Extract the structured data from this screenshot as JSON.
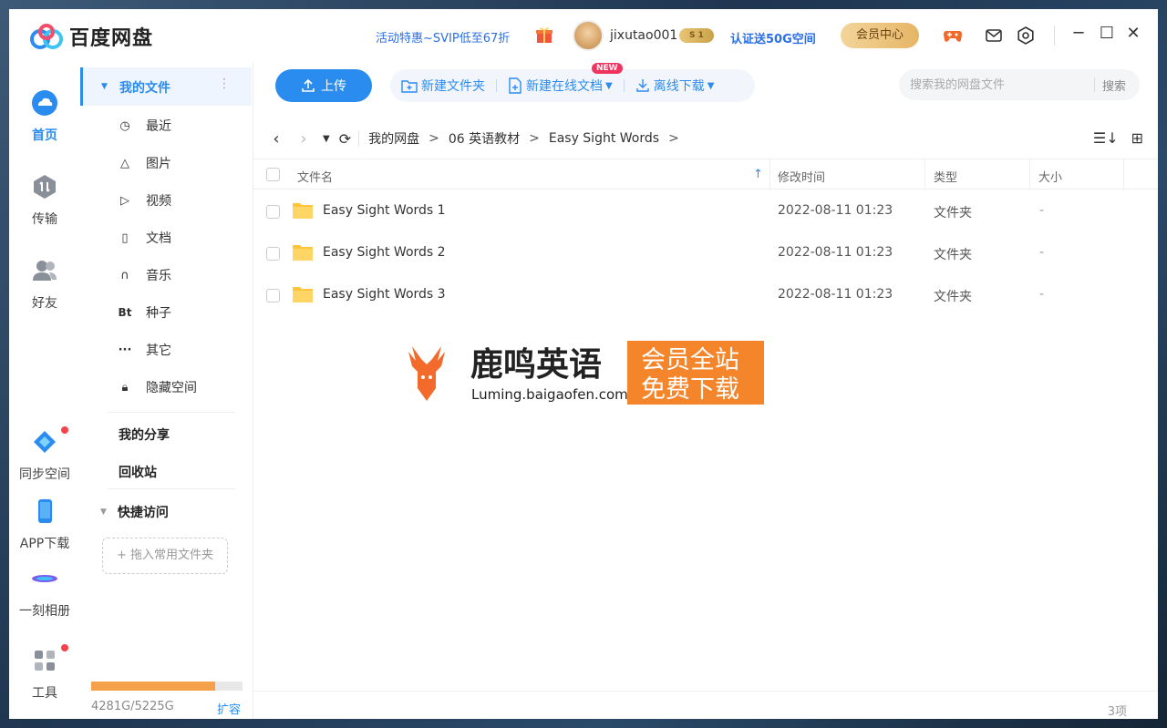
{
  "app": {
    "name": "百度网盘",
    "promo": "活动特惠~SVIP低至67折",
    "username": "jixutao001",
    "vip_level": "S 1",
    "verify": "认证送50G空间",
    "member_center": "会员中心"
  },
  "rail": {
    "items": [
      {
        "label": "首页"
      },
      {
        "label": "传输"
      },
      {
        "label": "好友"
      },
      {
        "label": "同步空间"
      },
      {
        "label": "APP下载"
      },
      {
        "label": "一刻相册"
      },
      {
        "label": "工具"
      }
    ]
  },
  "sidebar": {
    "my_files": "我的文件",
    "items": [
      {
        "icon": "clock-icon",
        "label": "最近"
      },
      {
        "icon": "image-icon",
        "label": "图片"
      },
      {
        "icon": "play-icon",
        "label": "视频"
      },
      {
        "icon": "document-icon",
        "label": "文档"
      },
      {
        "icon": "headphones-icon",
        "label": "音乐"
      },
      {
        "icon": "torrent-icon",
        "label": "种子",
        "glyph": "Bt"
      },
      {
        "icon": "more-icon",
        "label": "其它",
        "glyph": "···"
      },
      {
        "icon": "lock-icon",
        "label": "隐藏空间"
      }
    ],
    "my_share": "我的分享",
    "recycle": "回收站",
    "quick_access": "快捷访问",
    "drop_hint": "+ 拖入常用文件夹",
    "storage_used": 4281,
    "storage_total": 5225,
    "storage_text": "4281G/5225G",
    "expand": "扩容"
  },
  "toolbar": {
    "upload": "上传",
    "new_folder": "新建文件夹",
    "new_online_doc": "新建在线文档",
    "new_badge": "NEW",
    "offline_download": "离线下载",
    "search_placeholder": "搜索我的网盘文件",
    "search_button": "搜索"
  },
  "breadcrumb": [
    "我的网盘",
    "06 英语教材",
    "Easy Sight Words"
  ],
  "table": {
    "headers": {
      "name": "文件名",
      "modified": "修改时间",
      "type": "类型",
      "size": "大小"
    },
    "rows": [
      {
        "name": "Easy Sight Words 1",
        "modified": "2022-08-11 01:23",
        "type": "文件夹",
        "size": "-"
      },
      {
        "name": "Easy Sight Words 2",
        "modified": "2022-08-11 01:23",
        "type": "文件夹",
        "size": "-"
      },
      {
        "name": "Easy Sight Words 3",
        "modified": "2022-08-11 01:23",
        "type": "文件夹",
        "size": "-"
      }
    ]
  },
  "watermark": {
    "brand": "鹿鸣英语",
    "url": "Luming.baigaofen.com",
    "line1": "会员全站",
    "line2": "免费下载"
  },
  "status": {
    "count": "3项"
  },
  "colors": {
    "accent": "#2b8cf0",
    "folder": "#ffc53d",
    "storage": "#f5a04a",
    "badge": "#f0345e"
  }
}
